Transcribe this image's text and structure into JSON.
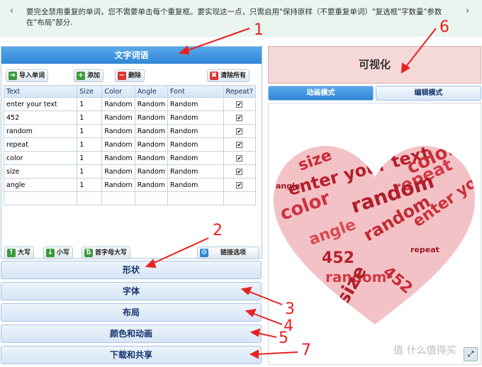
{
  "tip": {
    "left_arrow": "‹",
    "right_arrow": "›",
    "text": "要完全禁用重复的单词，您不需要单击每个重复框。要实现这一点，只需启用\"保持原样（不要重复单词）\"复选框\"字数量\"参数在\"布局\"部分."
  },
  "panel": {
    "title": "文字词语"
  },
  "toolbar": {
    "import": "导入单词",
    "add": "添加",
    "delete": "删除",
    "clear": "清除所有"
  },
  "table": {
    "headers": [
      "Text",
      "Size",
      "Color",
      "Angle",
      "Font",
      "Repeat?"
    ],
    "rows": [
      [
        "enter your text",
        "1",
        "Random",
        "Random",
        "Random"
      ],
      [
        "452",
        "1",
        "Random",
        "Random",
        "Random"
      ],
      [
        "random",
        "1",
        "Random",
        "Random",
        "Random"
      ],
      [
        "repeat",
        "1",
        "Random",
        "Random",
        "Random"
      ],
      [
        "color",
        "1",
        "Random",
        "Random",
        "Random"
      ],
      [
        "size",
        "1",
        "Random",
        "Random",
        "Random"
      ],
      [
        "angle",
        "1",
        "Random",
        "Random",
        "Random"
      ]
    ]
  },
  "bottom_toolbar": {
    "upper": "大写",
    "lower": "小写",
    "capitalize": "首字母大写",
    "link": "链接选项"
  },
  "sections": [
    "形状",
    "字体",
    "布局",
    "颜色和动画",
    "下载和共享"
  ],
  "viz": {
    "title": "可视化",
    "tab_anim": "动画模式",
    "tab_edit": "编辑模式"
  },
  "annotations": [
    "1",
    "2",
    "3",
    "4",
    "5",
    "6",
    "7"
  ],
  "watermark": "什么值得买",
  "colors": {
    "accent": "#2f86d6",
    "heart": "#e8555e",
    "annotation": "#e82222"
  }
}
